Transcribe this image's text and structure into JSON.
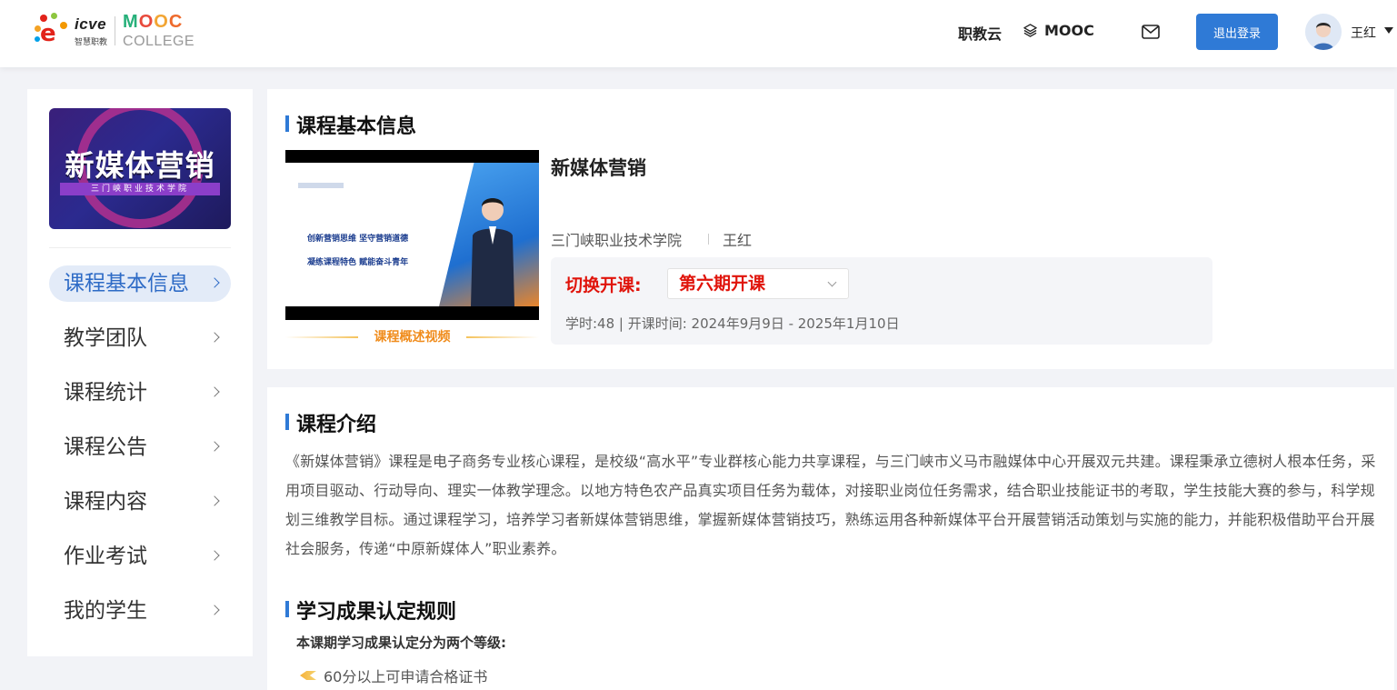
{
  "header": {
    "logo_icve_text": "icve",
    "logo_icve_sub": "智慧职教",
    "logo_mooc_letters": [
      "M",
      "O",
      "O",
      "C"
    ],
    "logo_mooc_colors": [
      "#27b07a",
      "#e84a3c",
      "#f2a533",
      "#ee6a2c"
    ],
    "logo_college": "COLLEGE",
    "nav_zhijiaoyun": "职教云",
    "nav_mooc": "MOOC",
    "logout_label": "退出登录",
    "username": "王红"
  },
  "sidebar": {
    "cover_title": "新媒体营销",
    "cover_subtitle": "三门峡职业技术学院",
    "items": [
      {
        "label": "课程基本信息",
        "active": true
      },
      {
        "label": "教学团队",
        "active": false
      },
      {
        "label": "课程统计",
        "active": false
      },
      {
        "label": "课程公告",
        "active": false
      },
      {
        "label": "课程内容",
        "active": false
      },
      {
        "label": "作业考试",
        "active": false
      },
      {
        "label": "我的学生",
        "active": false
      }
    ]
  },
  "course_info": {
    "section_title": "课程基本信息",
    "video_lines": [
      "创新营销思维  坚守营销道德",
      "凝练课程特色  赋能奋斗青年"
    ],
    "video_label": "课程概述视频",
    "course_name": "新媒体营销",
    "school": "三门峡职业技术学院",
    "teacher": "王红",
    "switch_label": "切换开课:",
    "term_selected": "第六期开课",
    "meta": "学时:48 | 开课时间: 2024年9月9日 - 2025年1月10日"
  },
  "course_intro": {
    "section_title": "课程介绍",
    "text": "《新媒体营销》课程是电子商务专业核心课程，是校级“高水平”专业群核心能力共享课程，与三门峡市义马市融媒体中心开展双元共建。课程秉承立德树人根本任务，采用项目驱动、行动导向、理实一体教学理念。以地方特色农产品真实项目任务为载体，对接职业岗位任务需求，结合职业技能证书的考取，学生技能大赛的参与，科学规划三维教学目标。通过课程学习，培养学习者新媒体营销思维，掌握新媒体营销技巧，熟练运用各种新媒体平台开展营销活动策划与实施的能力，并能积极借助平台开展社会服务，传递“中原新媒体人”职业素养。"
  },
  "rules": {
    "section_title": "学习成果认定规则",
    "subtitle": "本课期学习成果认定分为两个等级:",
    "items": [
      "60分以上可申请合格证书"
    ]
  }
}
